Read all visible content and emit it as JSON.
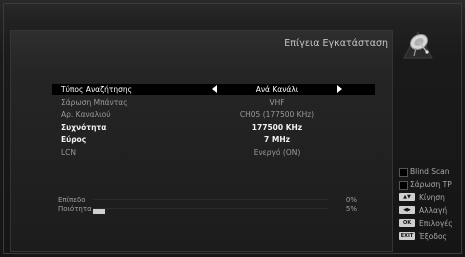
{
  "header": {
    "title": "Επίγεια Εγκατάσταση",
    "logo_icon": "satellite-dish-icon"
  },
  "settings": [
    {
      "label": "Τύπος Αναζήτησης",
      "value": "Ανά Κανάλι"
    },
    {
      "label": "Σάρωση Μπάντας",
      "value": "VHF"
    },
    {
      "label": "Αρ. Καναλιού",
      "value": "CH05 (177500 KHz)"
    },
    {
      "label": "Συχνότητα",
      "value": "177500 KHz"
    },
    {
      "label": "Εύρος",
      "value": "7 MHz"
    },
    {
      "label": "LCN",
      "value": "Ενεργό (ON)"
    }
  ],
  "signal": {
    "level_label": "Επίπεδο",
    "level_value": "0%",
    "level_fraction": 0.0,
    "quality_label": "Ποιότητα",
    "quality_value": "5%",
    "quality_fraction": 0.05
  },
  "legend": {
    "blind_scan": "Blind Scan",
    "scan_tp": "Σάρωση TP",
    "move": "Κίνηση",
    "change": "Αλλαγή",
    "options_key": "OK",
    "options": "Επιλογές",
    "exit_key": "EXIT",
    "exit": "Έξοδος"
  },
  "colors": {
    "selected_row": "#000000",
    "highlight_text": "#f2f2f2",
    "meter_fill": "#cfcfcf"
  }
}
